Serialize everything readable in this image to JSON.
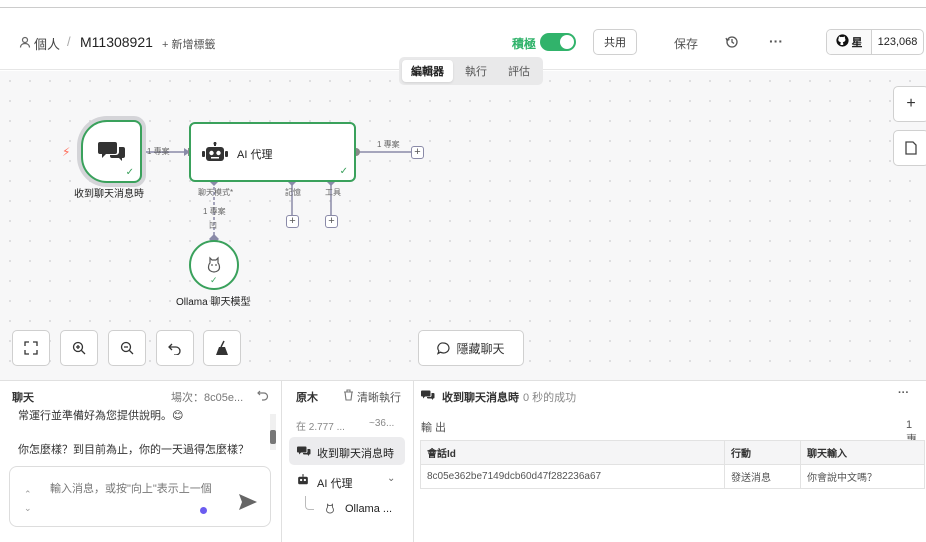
{
  "header": {
    "breadcrumb_root": "個人",
    "separator": "/",
    "workflow_name": "M11308921",
    "add_tag": "+ 新增標籤",
    "active_label": "積極",
    "share_label": "共用",
    "save_label": "保存",
    "more_label": "···",
    "star_label": "星",
    "star_count": "123,068"
  },
  "tabs": [
    {
      "label": "編輯器",
      "active": true
    },
    {
      "label": "執行",
      "active": false
    },
    {
      "label": "評估",
      "active": false
    }
  ],
  "canvas": {
    "trigger_label": "收到聊天消息時",
    "agent_label": "AI 代理",
    "model_label": "Ollama 聊天模型",
    "conn_items_1": "1 專案",
    "conn_items_2": "1 專案",
    "conn_items_3": "1 專案",
    "port_chat_model": "聊天模式*",
    "port_memory": "記憶",
    "port_tool": "工具",
    "model_marker": "凹",
    "hide_chat_label": "隱藏聊天"
  },
  "chat_panel": {
    "title": "聊天",
    "session_label": "場次：8c05e...",
    "msg1": "常運行並準備好為您提供說明。😊",
    "msg2": "你怎麼樣？到目前為止，你的一天過得怎麼樣？",
    "input_placeholder": "輸入消息，或按\"向上\"表示上一個"
  },
  "log_panel": {
    "title": "原木",
    "clear_label": "清晰執行",
    "time1": "在 2.777 ...",
    "time2": "~36...",
    "item1": "收到聊天消息時",
    "item2": "AI 代理",
    "item3": "Ollama ..."
  },
  "output_panel": {
    "node_title": "收到聊天消息時",
    "status": "0 秒的成功",
    "more_label": "···",
    "section_label": "輸 出",
    "count_label": "1 專",
    "columns": [
      "會話Id",
      "行動",
      "聊天輸入"
    ],
    "rows": [
      [
        "8c05e362be7149dcb60d47f282236a67",
        "發送消息",
        "你會說中文嗎？"
      ]
    ]
  },
  "colors": {
    "accent_green": "#31b36b",
    "node_border": "#3aa15c",
    "link_gray": "#8a8aa8"
  }
}
